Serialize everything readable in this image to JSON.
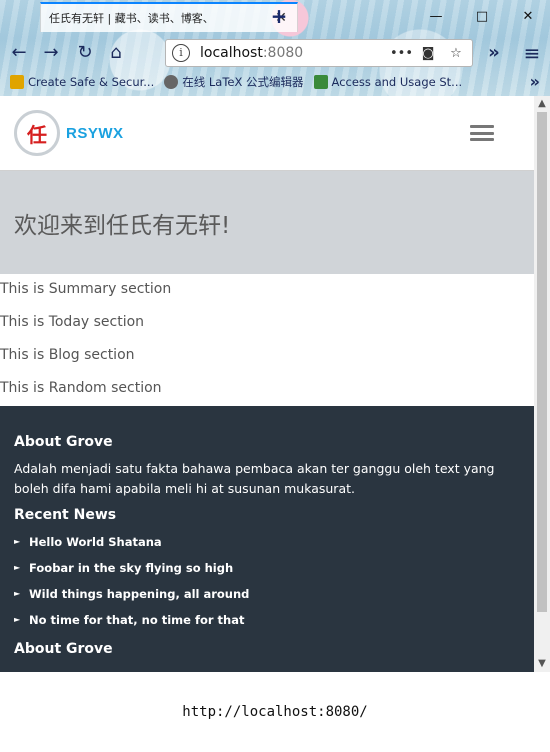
{
  "browser": {
    "tab_title": "任氏有无轩 | 藏书、读书、博客、",
    "tab_close": "✕",
    "new_tab": "+",
    "minimize": "—",
    "maximize": "□",
    "close": "✕",
    "back": "←",
    "forward": "→",
    "reload": "↻",
    "home": "⌂",
    "url_host": "localhost",
    "url_port": ":8080",
    "url_info": "i",
    "page_actions": "•••",
    "pocket": "◙",
    "star": "☆",
    "overflow": "»",
    "menu": "≡",
    "bookmarks": [
      {
        "label": "Create Safe & Secur...",
        "icon": "lock-icon",
        "color": "#e0a400"
      },
      {
        "label": "在线 LaTeX 公式编辑器",
        "icon": "gear-icon",
        "color": "#555555"
      },
      {
        "label": "Access and Usage St...",
        "icon": "feather-icon",
        "color": "#3a8a3a"
      }
    ],
    "bookmarks_more": "»"
  },
  "site": {
    "logo_char": "任",
    "brand": "RSYWX",
    "hero_title": "欢迎来到任氏有无轩!",
    "sections": [
      "This is Summary section",
      "This is Today section",
      "This is Blog section",
      "This is Random section"
    ],
    "footer": {
      "about_title": "About Grove",
      "about_text": "Adalah menjadi satu fakta bahawa pembaca akan ter ganggu oleh text yang boleh difa hami apabila meli hi at susunan mukasurat.",
      "news_title": "Recent News",
      "news": [
        "Hello World Shatana",
        "Foobar in the sky flying so high",
        "Wild things happening, all around",
        "No time for that, no time for that"
      ],
      "about_title_2": "About Grove"
    }
  },
  "status_url": "http://localhost:8080/"
}
